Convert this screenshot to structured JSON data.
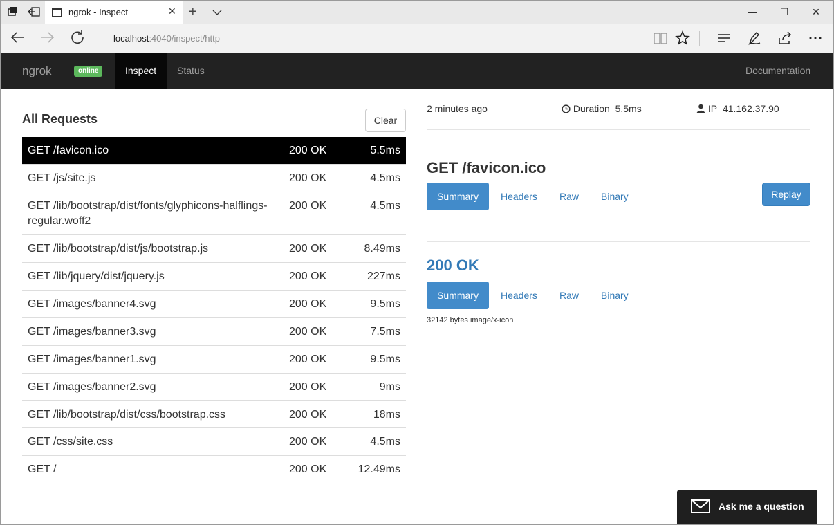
{
  "browser": {
    "tab_title": "ngrok - Inspect",
    "tab_close": "✕",
    "url_host": "localhost",
    "url_rest": ":4040/inspect/http",
    "window_controls": {
      "minimize": "—",
      "maximize": "☐",
      "close": "✕"
    },
    "new_tab": "+"
  },
  "navbar": {
    "brand": "ngrok",
    "badge": "online",
    "links": {
      "inspect": "Inspect",
      "status": "Status",
      "documentation": "Documentation"
    }
  },
  "requests_panel": {
    "title": "All Requests",
    "clear_label": "Clear",
    "rows": [
      {
        "path": "GET /favicon.ico",
        "status": "200 OK",
        "duration": "5.5ms"
      },
      {
        "path": "GET /js/site.js",
        "status": "200 OK",
        "duration": "4.5ms"
      },
      {
        "path": "GET /lib/bootstrap/dist/fonts/glyphicons-halflings-regular.woff2",
        "status": "200 OK",
        "duration": "4.5ms"
      },
      {
        "path": "GET /lib/bootstrap/dist/js/bootstrap.js",
        "status": "200 OK",
        "duration": "8.49ms"
      },
      {
        "path": "GET /lib/jquery/dist/jquery.js",
        "status": "200 OK",
        "duration": "227ms"
      },
      {
        "path": "GET /images/banner4.svg",
        "status": "200 OK",
        "duration": "9.5ms"
      },
      {
        "path": "GET /images/banner3.svg",
        "status": "200 OK",
        "duration": "7.5ms"
      },
      {
        "path": "GET /images/banner1.svg",
        "status": "200 OK",
        "duration": "9.5ms"
      },
      {
        "path": "GET /images/banner2.svg",
        "status": "200 OK",
        "duration": "9ms"
      },
      {
        "path": "GET /lib/bootstrap/dist/css/bootstrap.css",
        "status": "200 OK",
        "duration": "18ms"
      },
      {
        "path": "GET /css/site.css",
        "status": "200 OK",
        "duration": "4.5ms"
      },
      {
        "path": "GET /",
        "status": "200 OK",
        "duration": "12.49ms"
      }
    ]
  },
  "detail": {
    "time_ago": "2 minutes ago",
    "duration_label": "Duration",
    "duration_value": "5.5ms",
    "ip_label": "IP",
    "ip_value": "41.162.37.90",
    "request_title": "GET /favicon.ico",
    "request_tabs": [
      "Summary",
      "Headers",
      "Raw",
      "Binary"
    ],
    "replay_label": "Replay",
    "response_title": "200 OK",
    "response_tabs": [
      "Summary",
      "Headers",
      "Raw",
      "Binary"
    ],
    "response_summary": "32142 bytes image/x-icon"
  },
  "ask_widget": {
    "label": "Ask me a question"
  },
  "icons": [
    "tab-stack-icon",
    "set-aside-icon",
    "page-icon",
    "back-icon",
    "forward-icon",
    "refresh-icon",
    "reading-view-icon",
    "favorite-star-icon",
    "hub-icon",
    "pen-icon",
    "share-icon",
    "more-icon",
    "clock-icon",
    "user-icon",
    "envelope-icon"
  ],
  "colors": {
    "navbar": "#222222",
    "online_badge": "#5cb85c",
    "primary": "#428bca",
    "link": "#337ab7",
    "selected_row": "#000000"
  }
}
